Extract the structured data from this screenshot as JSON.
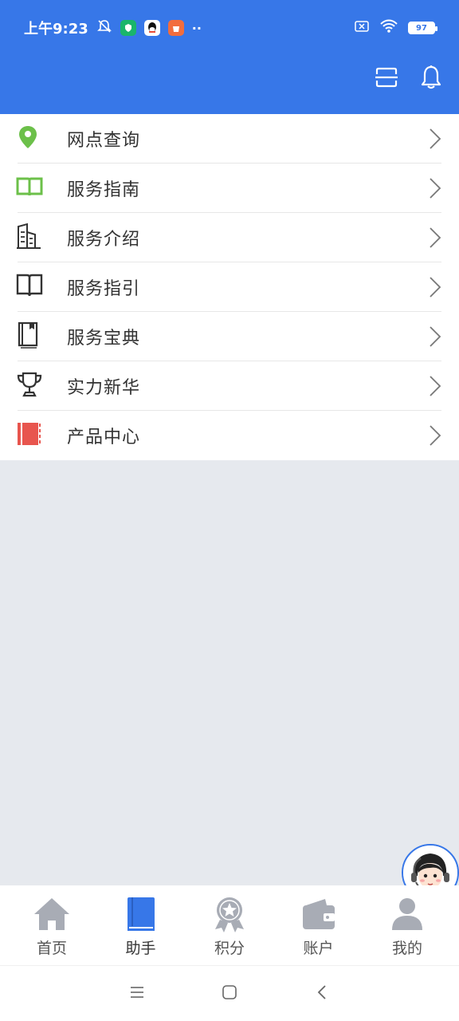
{
  "status": {
    "time": "上午9:23",
    "battery": "97"
  },
  "menu": {
    "items": [
      {
        "label": "网点查询",
        "icon": "location-pin-icon",
        "color": "#6cc04a"
      },
      {
        "label": "服务指南",
        "icon": "open-book-icon",
        "color": "#6cc04a"
      },
      {
        "label": "服务介绍",
        "icon": "building-icon",
        "color": "#333333"
      },
      {
        "label": "服务指引",
        "icon": "book-icon",
        "color": "#333333"
      },
      {
        "label": "服务宝典",
        "icon": "closed-book-icon",
        "color": "#333333"
      },
      {
        "label": "实力新华",
        "icon": "trophy-icon",
        "color": "#333333"
      },
      {
        "label": "产品中心",
        "icon": "product-book-icon",
        "color": "#e8554e"
      }
    ]
  },
  "bottom_nav": {
    "items": [
      {
        "label": "首页",
        "icon": "home-icon",
        "active": false
      },
      {
        "label": "助手",
        "icon": "assistant-book-icon",
        "active": true
      },
      {
        "label": "积分",
        "icon": "points-medal-icon",
        "active": false
      },
      {
        "label": "账户",
        "icon": "wallet-icon",
        "active": false
      },
      {
        "label": "我的",
        "icon": "profile-icon",
        "active": false
      }
    ]
  },
  "colors": {
    "brand": "#3777e8",
    "nav_inactive": "#a8acb5",
    "nav_active": "#3777e8",
    "page_bg": "#e6e9ee"
  }
}
